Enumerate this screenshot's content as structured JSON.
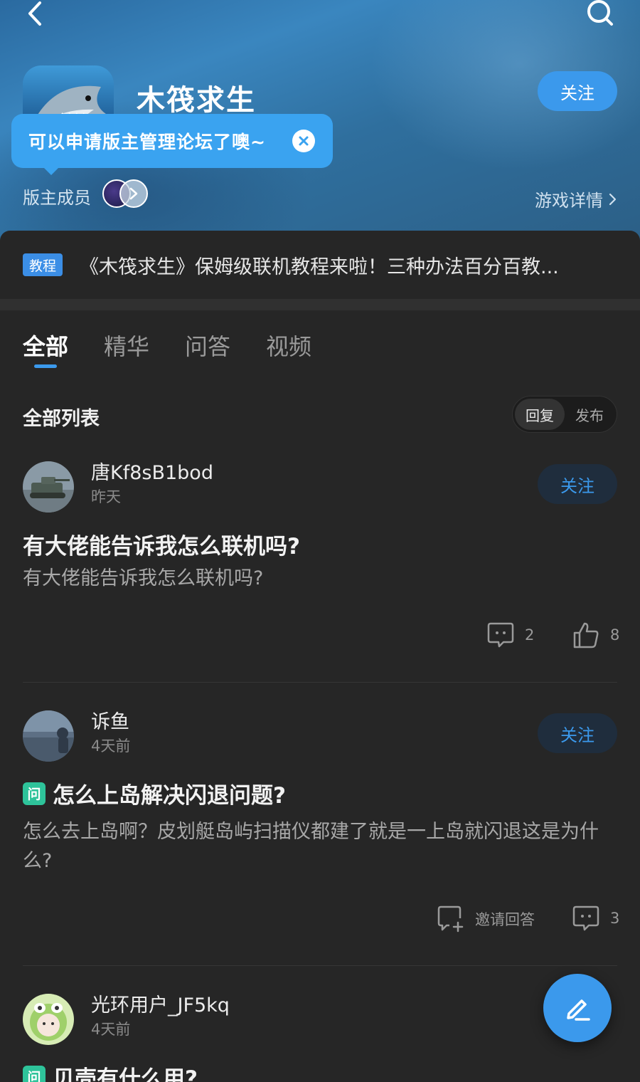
{
  "header": {
    "game_title": "木筏求生",
    "follow_label": "关注",
    "tooltip_text": "可以申请版主管理论坛了噢~",
    "moderators_label": "版主成员",
    "game_detail_label": "游戏详情"
  },
  "pinned": {
    "badge": "教程",
    "text": "《木筏求生》保姆级联机教程来啦！三种办法百分百教..."
  },
  "tabs": [
    {
      "label": "全部",
      "active": true
    },
    {
      "label": "精华",
      "active": false
    },
    {
      "label": "问答",
      "active": false
    },
    {
      "label": "视频",
      "active": false
    }
  ],
  "list": {
    "title": "全部列表",
    "sort_options": [
      "回复",
      "发布"
    ],
    "sort_active": "回复"
  },
  "posts": [
    {
      "username": "唐Kf8sB1bod",
      "time": "昨天",
      "follow_label": "关注",
      "title": "有大佬能告诉我怎么联机吗?",
      "body": "有大佬能告诉我怎么联机吗?",
      "comments": "2",
      "likes": "8"
    },
    {
      "username": "诉鱼",
      "time": "4天前",
      "follow_label": "关注",
      "question_badge": "问",
      "title": "怎么上岛解决闪退问题?",
      "body": "怎么去上岛啊？皮划艇岛屿扫描仪都建了就是一上岛就闪退这是为什么?",
      "invite_label": "邀请回答",
      "comments": "3"
    },
    {
      "username": "光环用户_JF5kq",
      "time": "4天前",
      "question_badge": "问",
      "title": "贝壳有什么用?"
    }
  ],
  "colors": {
    "accent": "#3b99ec",
    "background": "#262626",
    "question_badge": "#2ec39a"
  },
  "icons": [
    "back-arrow-icon",
    "search-icon",
    "close-icon",
    "chevron-right-icon",
    "comment-icon",
    "like-icon",
    "invite-icon",
    "edit-icon"
  ]
}
